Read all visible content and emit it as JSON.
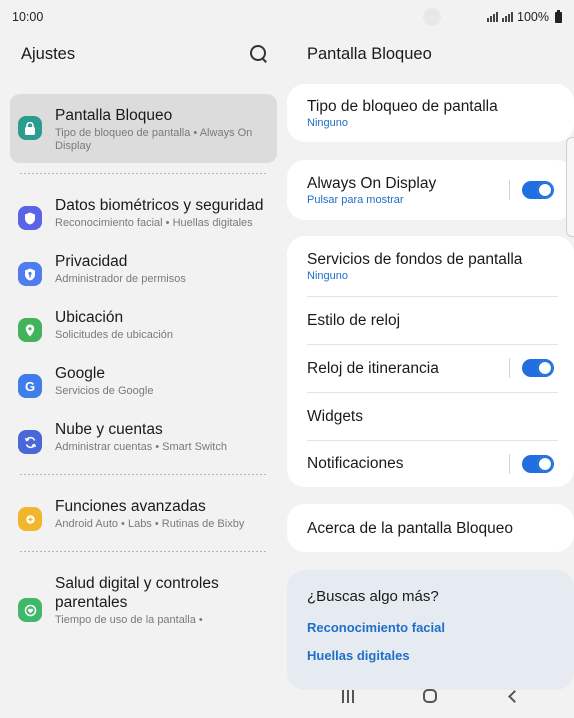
{
  "status": {
    "time": "10:00",
    "battery_text": "100%"
  },
  "left": {
    "title": "Ajustes",
    "items": [
      {
        "title": "Pantalla Bloqueo",
        "sub": "Tipo de bloqueo de pantalla • Always On Display",
        "color": "#2a9d8f",
        "icon": "lock-icon"
      },
      {
        "title": "Datos biométricos y seguridad",
        "sub": "Reconocimiento facial • Huellas digitales",
        "color": "#5b63e6",
        "icon": "shield-icon"
      },
      {
        "title": "Privacidad",
        "sub": "Administrador de permisos",
        "color": "#4e7df0",
        "icon": "privacy-icon"
      },
      {
        "title": "Ubicación",
        "sub": "Solicitudes de ubicación",
        "color": "#43b35b",
        "icon": "location-icon"
      },
      {
        "title": "Google",
        "sub": "Servicios de Google",
        "color": "#3f7de8",
        "icon": "google-icon"
      },
      {
        "title": "Nube y cuentas",
        "sub": "Administrar cuentas • Smart Switch",
        "color": "#4a67d8",
        "icon": "sync-icon"
      },
      {
        "title": "Funciones avanzadas",
        "sub": "Android Auto • Labs • Rutinas de Bixby",
        "color": "#f1b62d",
        "icon": "gear-plus-icon"
      },
      {
        "title": "Salud digital y controles parentales",
        "sub": "Tiempo de uso de la pantalla •",
        "color": "#3fb86a",
        "icon": "wellbeing-icon"
      }
    ]
  },
  "right": {
    "title": "Pantalla Bloqueo",
    "lock_type": {
      "title": "Tipo de bloqueo de pantalla",
      "sub": "Ninguno"
    },
    "aod": {
      "title": "Always On Display",
      "sub": "Pulsar para mostrar"
    },
    "wallpaper": {
      "title": "Servicios de fondos de pantalla",
      "sub": "Ninguno"
    },
    "clock_style": "Estilo de reloj",
    "roaming_clock": "Reloj de itinerancia",
    "widgets": "Widgets",
    "notifications": "Notificaciones",
    "about": "Acerca de la pantalla Bloqueo",
    "more": {
      "title": "¿Buscas algo más?",
      "links": [
        "Reconocimiento facial",
        "Huellas digitales"
      ]
    }
  },
  "colors": {
    "accent": "#1f6fe0",
    "link": "#1f6fc9"
  }
}
